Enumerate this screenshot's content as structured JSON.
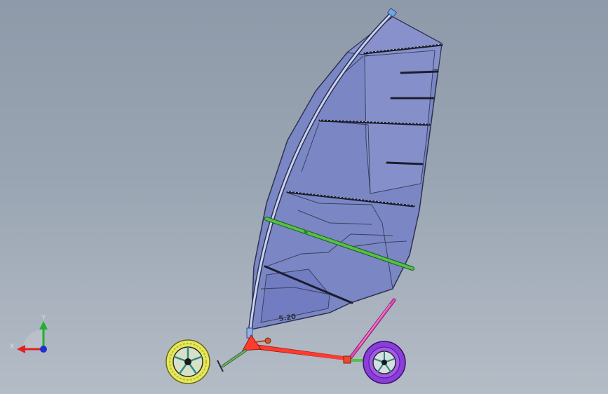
{
  "viewport": {
    "background_top": "#8e9aa9",
    "background_bottom": "#b4bcc6"
  },
  "model": {
    "sail_marking": "5.20",
    "colors": {
      "sail": "#7b86c4",
      "sail_edge": "#2c3250",
      "mast": "#c9d2f0",
      "boom": "#55c04a",
      "chassis": "#ff3b2e",
      "rear_strut": "#e24fb5",
      "front_wheel": "#e7e85a",
      "rear_wheel": "#8a3dd8"
    }
  },
  "triad": {
    "x_label": "X",
    "y_label": "Y",
    "x_color": "#e02020",
    "y_color": "#20b030",
    "z_color": "#2030d0",
    "icons": [
      "axis-x-arrow-icon",
      "axis-y-arrow-icon",
      "axis-z-dot-icon"
    ]
  }
}
